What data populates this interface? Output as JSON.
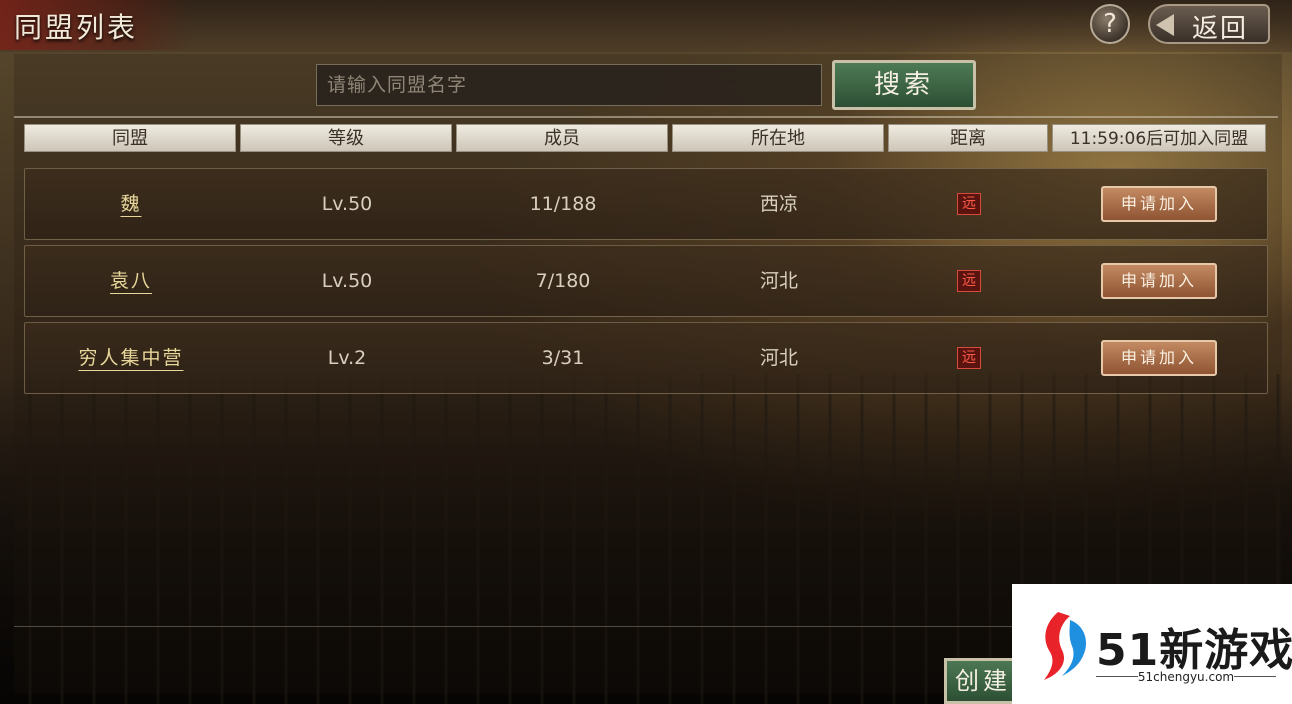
{
  "header": {
    "title": "同盟列表",
    "help_label": "?",
    "back_label": "返回"
  },
  "search": {
    "placeholder": "请输入同盟名字",
    "button_label": "搜索"
  },
  "table": {
    "columns": [
      "同盟",
      "等级",
      "成员",
      "所在地",
      "距离",
      "11:59:06后可加入同盟"
    ],
    "rows": [
      {
        "name": "魏",
        "level": "Lv.50",
        "members": "11/188",
        "location": "西凉",
        "distance": "远",
        "action": "申请加入"
      },
      {
        "name": "袁八",
        "level": "Lv.50",
        "members": "7/180",
        "location": "河北",
        "distance": "远",
        "action": "申请加入"
      },
      {
        "name": "穷人集中营",
        "level": "Lv.2",
        "members": "3/31",
        "location": "河北",
        "distance": "远",
        "action": "申请加入"
      }
    ]
  },
  "footer": {
    "create_label": "创建"
  },
  "watermark": {
    "brand": "51新游戏",
    "url": "51chengyu.com",
    "colors": {
      "red": "#e8232a",
      "blue": "#1f8fe0"
    }
  },
  "colors": {
    "distance_badge": "#ff5a48",
    "join_button": "#b07048",
    "search_button": "#3e6644"
  }
}
